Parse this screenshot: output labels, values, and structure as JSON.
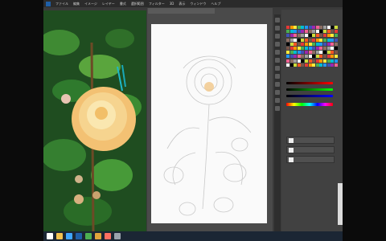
{
  "menubar": {
    "items": [
      "ファイル",
      "編集",
      "イメージ",
      "レイヤー",
      "書式",
      "選択範囲",
      "フィルター",
      "3D",
      "表示",
      "ウィンドウ",
      "ヘルプ"
    ]
  },
  "canvas": {
    "tab_label": ""
  },
  "panels": {
    "swatch_colors": [
      "#e53935",
      "#ff9800",
      "#ffeb3b",
      "#4caf50",
      "#00bcd4",
      "#2196f3",
      "#3f51b5",
      "#9c27b0",
      "#f06292",
      "#8d6e63",
      "#9e9e9e",
      "#ffffff",
      "#000000",
      "#cddc39",
      "#ff5722",
      "#795548"
    ],
    "layers": [
      "",
      "",
      ""
    ]
  },
  "taskbar": {
    "apps": [
      {
        "name": "start-icon",
        "color": "#ffffff"
      },
      {
        "name": "explorer-icon",
        "color": "#f2c14e"
      },
      {
        "name": "browser-icon",
        "color": "#3ea6ff"
      },
      {
        "name": "photoshop-icon",
        "color": "#1f5fa7"
      },
      {
        "name": "paint-icon",
        "color": "#4caf50"
      },
      {
        "name": "folder-icon",
        "color": "#e0a53b"
      },
      {
        "name": "media-icon",
        "color": "#ff6f61"
      },
      {
        "name": "tools-icon",
        "color": "#9aa3ad"
      }
    ],
    "clock": ""
  }
}
